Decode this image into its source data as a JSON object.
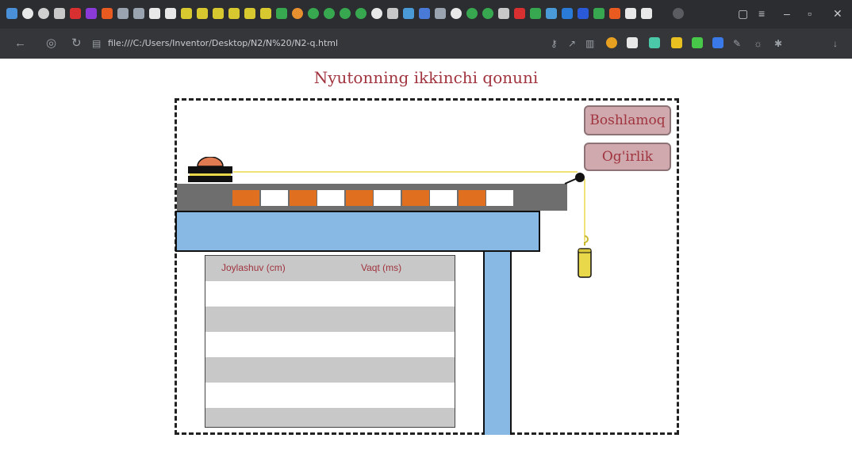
{
  "browser": {
    "url": "file:///C:/Users/Inventor/Desktop/N2/N%20/N2-q.html"
  },
  "page": {
    "title": "Nyutonning ikkinchi qonuni"
  },
  "controls": {
    "start_label": "Boshlamoq",
    "weight_label": "Og'irlik"
  },
  "table": {
    "columns": [
      "Joylashuv (cm)",
      "Vaqt (ms)"
    ],
    "rows": [
      [
        "",
        ""
      ],
      [
        "",
        ""
      ],
      [
        "",
        ""
      ],
      [
        "",
        ""
      ],
      [
        "",
        ""
      ],
      [
        "",
        ""
      ],
      [
        "",
        ""
      ]
    ]
  },
  "colors": {
    "title": "#a0343f",
    "accent": "#e07020",
    "table_blue": "#88b8e4",
    "button_bg": "#cfa9ad",
    "weight_yellow": "#e8d84a"
  }
}
